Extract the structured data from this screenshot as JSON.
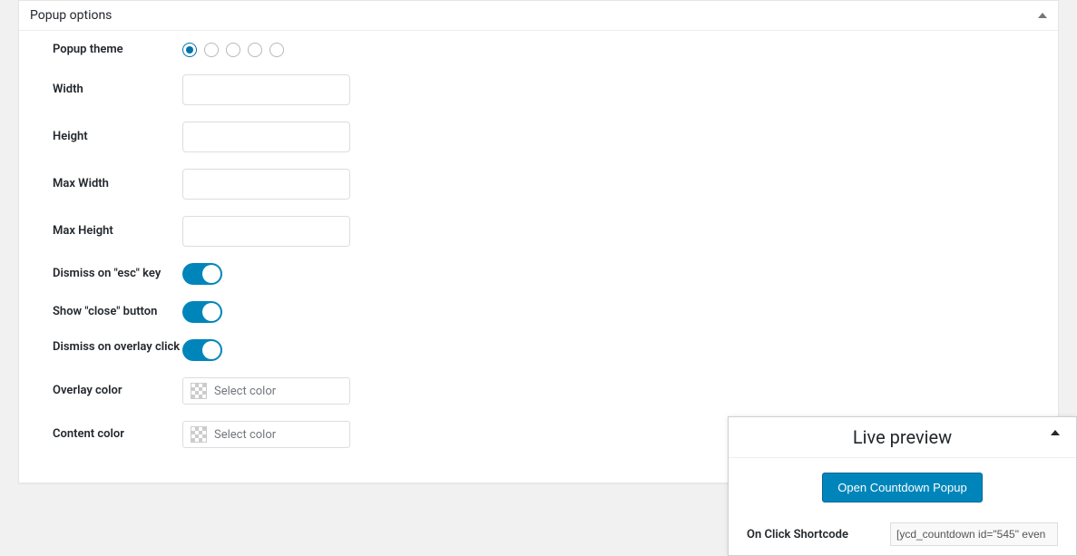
{
  "panel": {
    "title": "Popup options",
    "fields": {
      "popup_theme_label": "Popup theme",
      "width_label": "Width",
      "height_label": "Height",
      "max_width_label": "Max Width",
      "max_height_label": "Max Height",
      "dismiss_esc_label": "Dismiss on \"esc\" key",
      "show_close_label": "Show \"close\" button",
      "dismiss_overlay_label": "Dismiss on overlay click",
      "overlay_color_label": "Overlay color",
      "content_color_label": "Content color",
      "color_placeholder": "Select color"
    },
    "values": {
      "width": "",
      "height": "",
      "max_width": "",
      "max_height": ""
    },
    "theme_selected": 0,
    "toggles": {
      "dismiss_esc": true,
      "show_close": true,
      "dismiss_overlay": true
    }
  },
  "live_preview": {
    "title": "Live preview",
    "button_label": "Open Countdown Popup",
    "shortcode_label": "On Click Shortcode",
    "shortcode_value": "[ycd_countdown id=\"545\" even"
  }
}
